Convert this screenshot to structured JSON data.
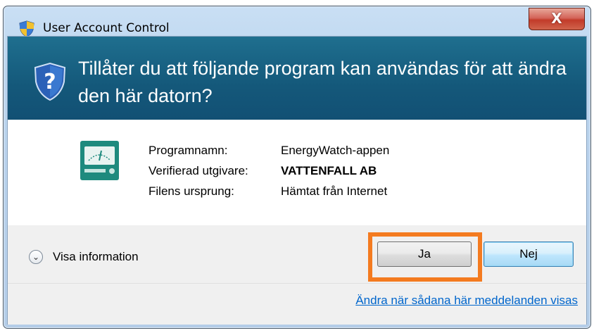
{
  "window": {
    "title": "User Account Control",
    "close_label": "X"
  },
  "banner": {
    "question": "Tillåter du att följande program kan användas för att ändra den här datorn?"
  },
  "details": [
    {
      "label": "Programnamn:",
      "value": "EnergyWatch-appen",
      "bold": false
    },
    {
      "label": "Verifierad utgivare:",
      "value": "VATTENFALL AB",
      "bold": true
    },
    {
      "label": "Filens ursprung:",
      "value": "Hämtat från Internet",
      "bold": false
    }
  ],
  "footer": {
    "expander_label": "Visa information",
    "yes_label": "Ja",
    "no_label": "Nej",
    "settings_link": "Ändra när sådana här meddelanden visas"
  },
  "colors": {
    "banner": "#14587a",
    "highlight": "#f47b20",
    "link": "#0066cc"
  },
  "icons": {
    "title": "uac-shield-icon",
    "banner": "uac-question-shield-icon",
    "app": "energywatch-app-icon",
    "expander": "chevron-down-icon"
  }
}
